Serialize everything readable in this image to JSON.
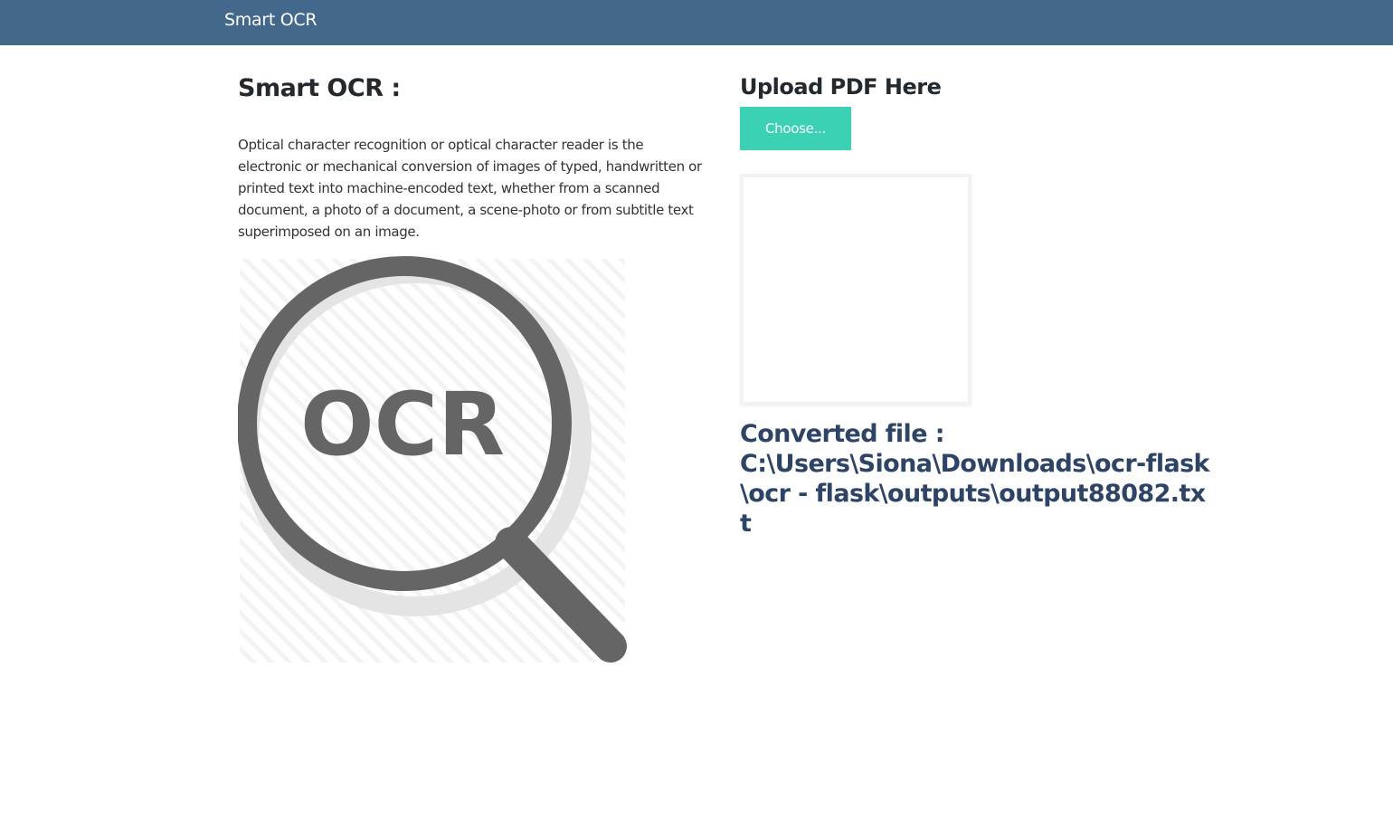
{
  "navbar": {
    "brand": "Smart OCR"
  },
  "intro": {
    "title": "Smart OCR :",
    "description": "Optical character recognition or optical character reader is the electronic or mechanical conversion of images of typed, handwritten or printed text into machine-encoded text, whether from a scanned document, a photo of a document, a scene-photo or from subtitle text superimposed on an image.",
    "graphic_label": "OCR",
    "graphic_icon": "magnifier-icon"
  },
  "upload": {
    "heading": "Upload PDF Here",
    "choose_label": "Choose...",
    "converted_label": "Converted file :",
    "converted_path": "C:\\Users\\Siona\\Downloads\\ocr-flask\\ocr - flask\\outputs\\output88082.txt"
  },
  "colors": {
    "navbar": "#43688c",
    "accent": "#3bd1b5",
    "converted_text": "#2e4466",
    "icon_gray": "#656565"
  }
}
